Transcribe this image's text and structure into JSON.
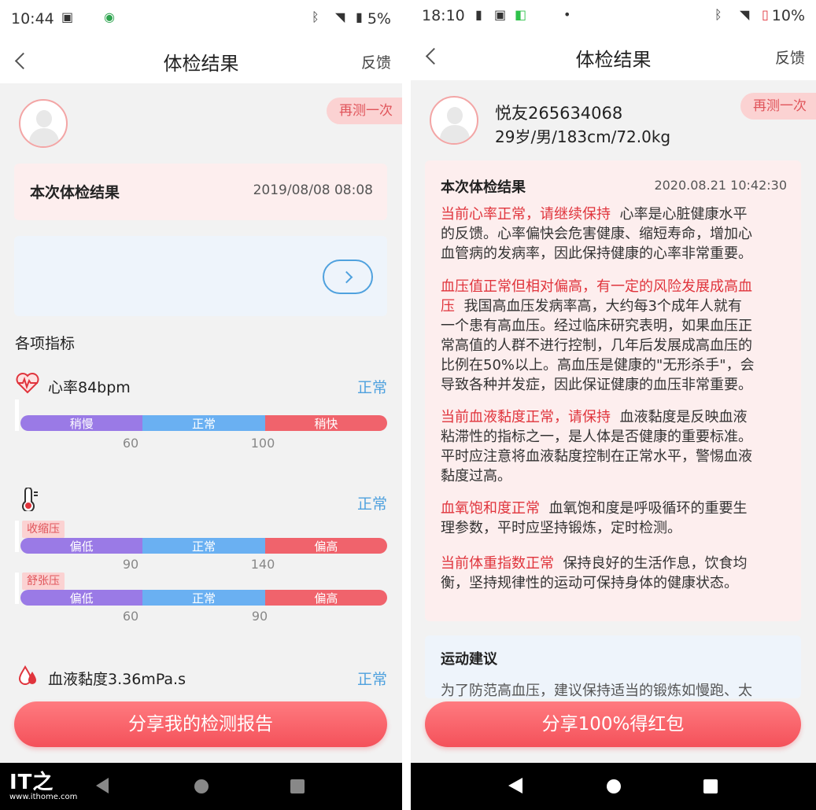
{
  "left": {
    "status": {
      "time": "10:44",
      "battery": "5%"
    },
    "header": {
      "title": "体检结果",
      "feedback": "反馈"
    },
    "retest": "再测一次",
    "result_card": {
      "title": "本次体检结果",
      "date": "2019/08/08 08:08"
    },
    "section_title": "各项指标",
    "heart": {
      "label": "心率84bpm",
      "status": "正常",
      "segments": [
        "稍慢",
        "正常",
        "稍快"
      ],
      "ticks": [
        "60",
        "100"
      ]
    },
    "bp": {
      "status": "正常",
      "systolic": {
        "tag": "收缩压",
        "segments": [
          "偏低",
          "正常",
          "偏高"
        ],
        "ticks": [
          "90",
          "140"
        ]
      },
      "diastolic": {
        "tag": "舒张压",
        "segments": [
          "偏低",
          "正常",
          "偏高"
        ],
        "ticks": [
          "60",
          "90"
        ]
      }
    },
    "viscosity": {
      "label": "血液黏度3.36mPa.s",
      "status": "正常"
    },
    "share_button": "分享我的检测报告",
    "watermark": {
      "site": "www.ithome.com"
    }
  },
  "right": {
    "status": {
      "time": "18:10",
      "battery": "10%"
    },
    "header": {
      "title": "体检结果",
      "feedback": "反馈"
    },
    "retest": "再测一次",
    "user": {
      "name": "悦友265634068",
      "info": "29岁/男/183cm/72.0kg"
    },
    "result_card": {
      "title": "本次体检结果",
      "date": "2020.08.21 10:42:30",
      "p1_hl": "当前心率正常，请继续保持",
      "p1_l1": "心率是心脏健康水平",
      "p1_l2": "的反馈。心率偏快会危害健康、缩短寿命，增加心",
      "p1_l3": "血管病的发病率，因此保持健康的心率非常重要。",
      "p2_hl1": "血压值正常但相对偏高，有一定的风险发展成高血",
      "p2_hl2": "压",
      "p2_l1": "我国高血压发病率高，大约每3个成年人就有",
      "p2_l2": "一个患有高血压。经过临床研究表明，如果血压正",
      "p2_l3": "常高值的人群不进行控制，几年后发展成高血压的",
      "p2_l4": "比例在50%以上。高血压是健康的\"无形杀手\"，会",
      "p2_l5": "导致各种并发症，因此保证健康的血压非常重要。",
      "p3_hl": "当前血液黏度正常，请保持",
      "p3_l1": "血液黏度是反映血液",
      "p3_l2": "粘滞性的指标之一，是人体是否健康的重要标准。",
      "p3_l3": "平时应注意将血液黏度控制在正常水平，警惕血液",
      "p3_l4": "黏度过高。",
      "p4_hl": "血氧饱和度正常",
      "p4_l1": "血氧饱和度是呼吸循环的重要生",
      "p4_l2": "理参数，平时应坚持锻炼，定时检测。",
      "p5_hl": "当前体重指数正常",
      "p5_l1": "保持良好的生活作息，饮食均",
      "p5_l2": "衡，坚持规律性的运动可保持身体的健康状态。"
    },
    "exercise": {
      "title": "运动建议",
      "preview": "为了防范高血压，建议保持适当的锻炼如慢跑、太"
    },
    "share_button": "分享100%得红包"
  }
}
